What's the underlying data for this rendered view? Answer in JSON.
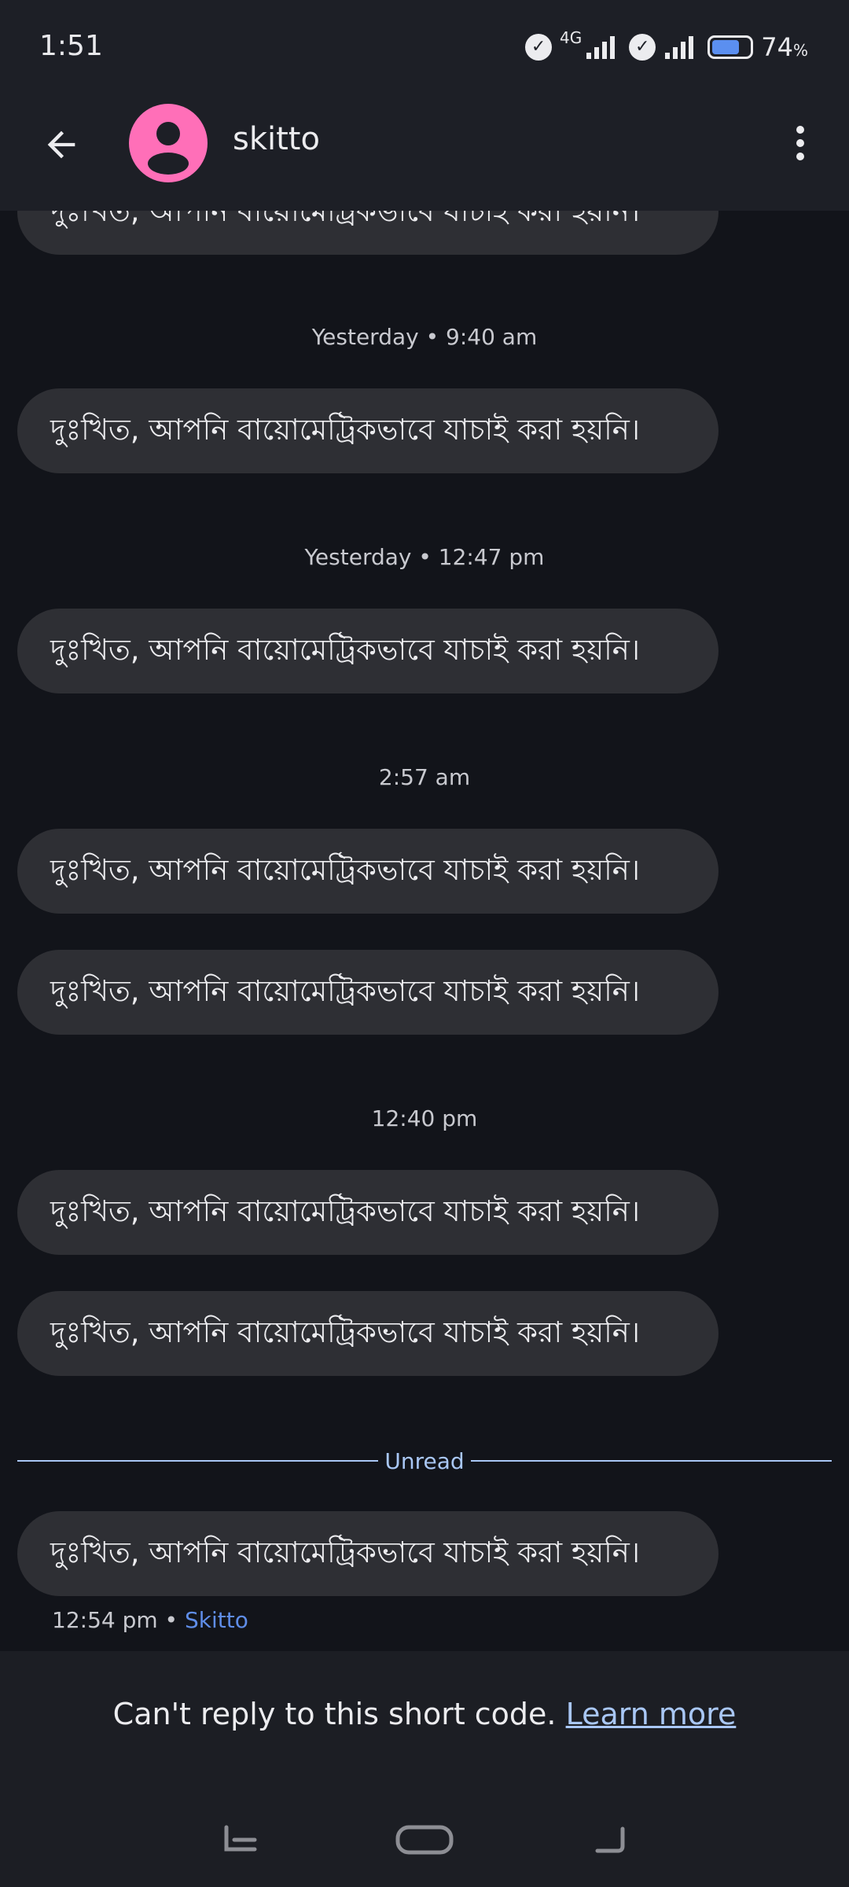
{
  "status_bar": {
    "time": "1:51",
    "network_label": "4G",
    "battery_percent": "74",
    "battery_unit": "%",
    "battery_level": 0.74
  },
  "header": {
    "contact_name": "skitto",
    "avatar_color": "#ff6fb8",
    "back_icon": "arrow-left-icon",
    "menu_icon": "more-vert-icon"
  },
  "messages": [
    {
      "text": "দুঃখিত, আপনি বায়োমেট্রিকভাবে যাচাই করা হয়নি।"
    },
    {
      "timestamp": "Yesterday • 9:40 am",
      "text": "দুঃখিত, আপনি বায়োমেট্রিকভাবে যাচাই করা হয়নি।"
    },
    {
      "timestamp": "Yesterday • 12:47 pm",
      "text": "দুঃখিত, আপনি বায়োমেট্রিকভাবে যাচাই করা হয়নি।"
    },
    {
      "timestamp": "2:57 am",
      "text": "দুঃখিত, আপনি বায়োমেট্রিকভাবে যাচাই করা হয়নি।"
    },
    {
      "text": "দুঃখিত, আপনি বায়োমেট্রিকভাবে যাচাই করা হয়নি।"
    },
    {
      "timestamp": "12:40 pm",
      "text": "দুঃখিত, আপনি বায়োমেট্রিকভাবে যাচাই করা হয়নি।"
    },
    {
      "text": "দুঃখিত, আপনি বায়োমেট্রিকভাবে যাচাই করা হয়নি।"
    },
    {
      "text": "দুঃখিত, আপনি বায়োমেট্রিকভাবে যাচাই করা হয়নি।"
    }
  ],
  "unread_label": "Unread",
  "last_message_meta": {
    "time": "12:54 pm",
    "separator": "•",
    "sender": "Skitto"
  },
  "footer": {
    "notice": "Can't reply to this short code.",
    "learn_more": "Learn more"
  },
  "colors": {
    "background": "#12141a",
    "header": "#1d1f26",
    "bubble": "#2e2f34",
    "accent": "#a9c7f5",
    "sender": "#5f8de8"
  }
}
